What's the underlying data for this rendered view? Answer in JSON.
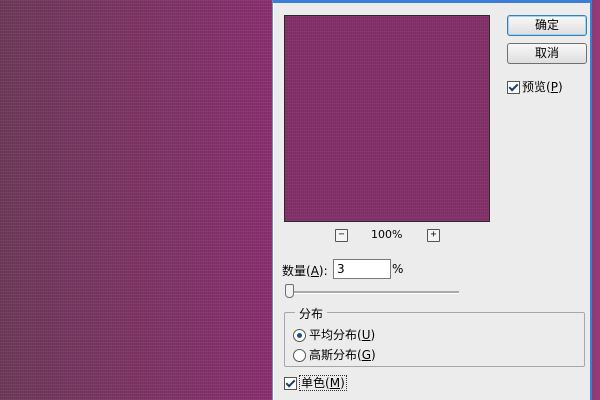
{
  "buttons": {
    "ok": "确定",
    "cancel": "取消"
  },
  "preview_checkbox": {
    "label": "预览",
    "accel": "P",
    "checked": true
  },
  "zoom": {
    "minus": "−",
    "plus": "+",
    "level": "100%"
  },
  "amount": {
    "label": "数量",
    "accel": "A",
    "value": "3",
    "unit": "%"
  },
  "distribution": {
    "title": "分布",
    "options": [
      {
        "label": "平均分布",
        "accel": "U",
        "selected": true
      },
      {
        "label": "高斯分布",
        "accel": "G",
        "selected": false
      }
    ]
  },
  "monochrome": {
    "label": "单色",
    "accel": "M",
    "checked": true
  },
  "colors": {
    "canvas": "#7c3564",
    "preview": "#84306a",
    "accent": "#3b7ed6"
  }
}
